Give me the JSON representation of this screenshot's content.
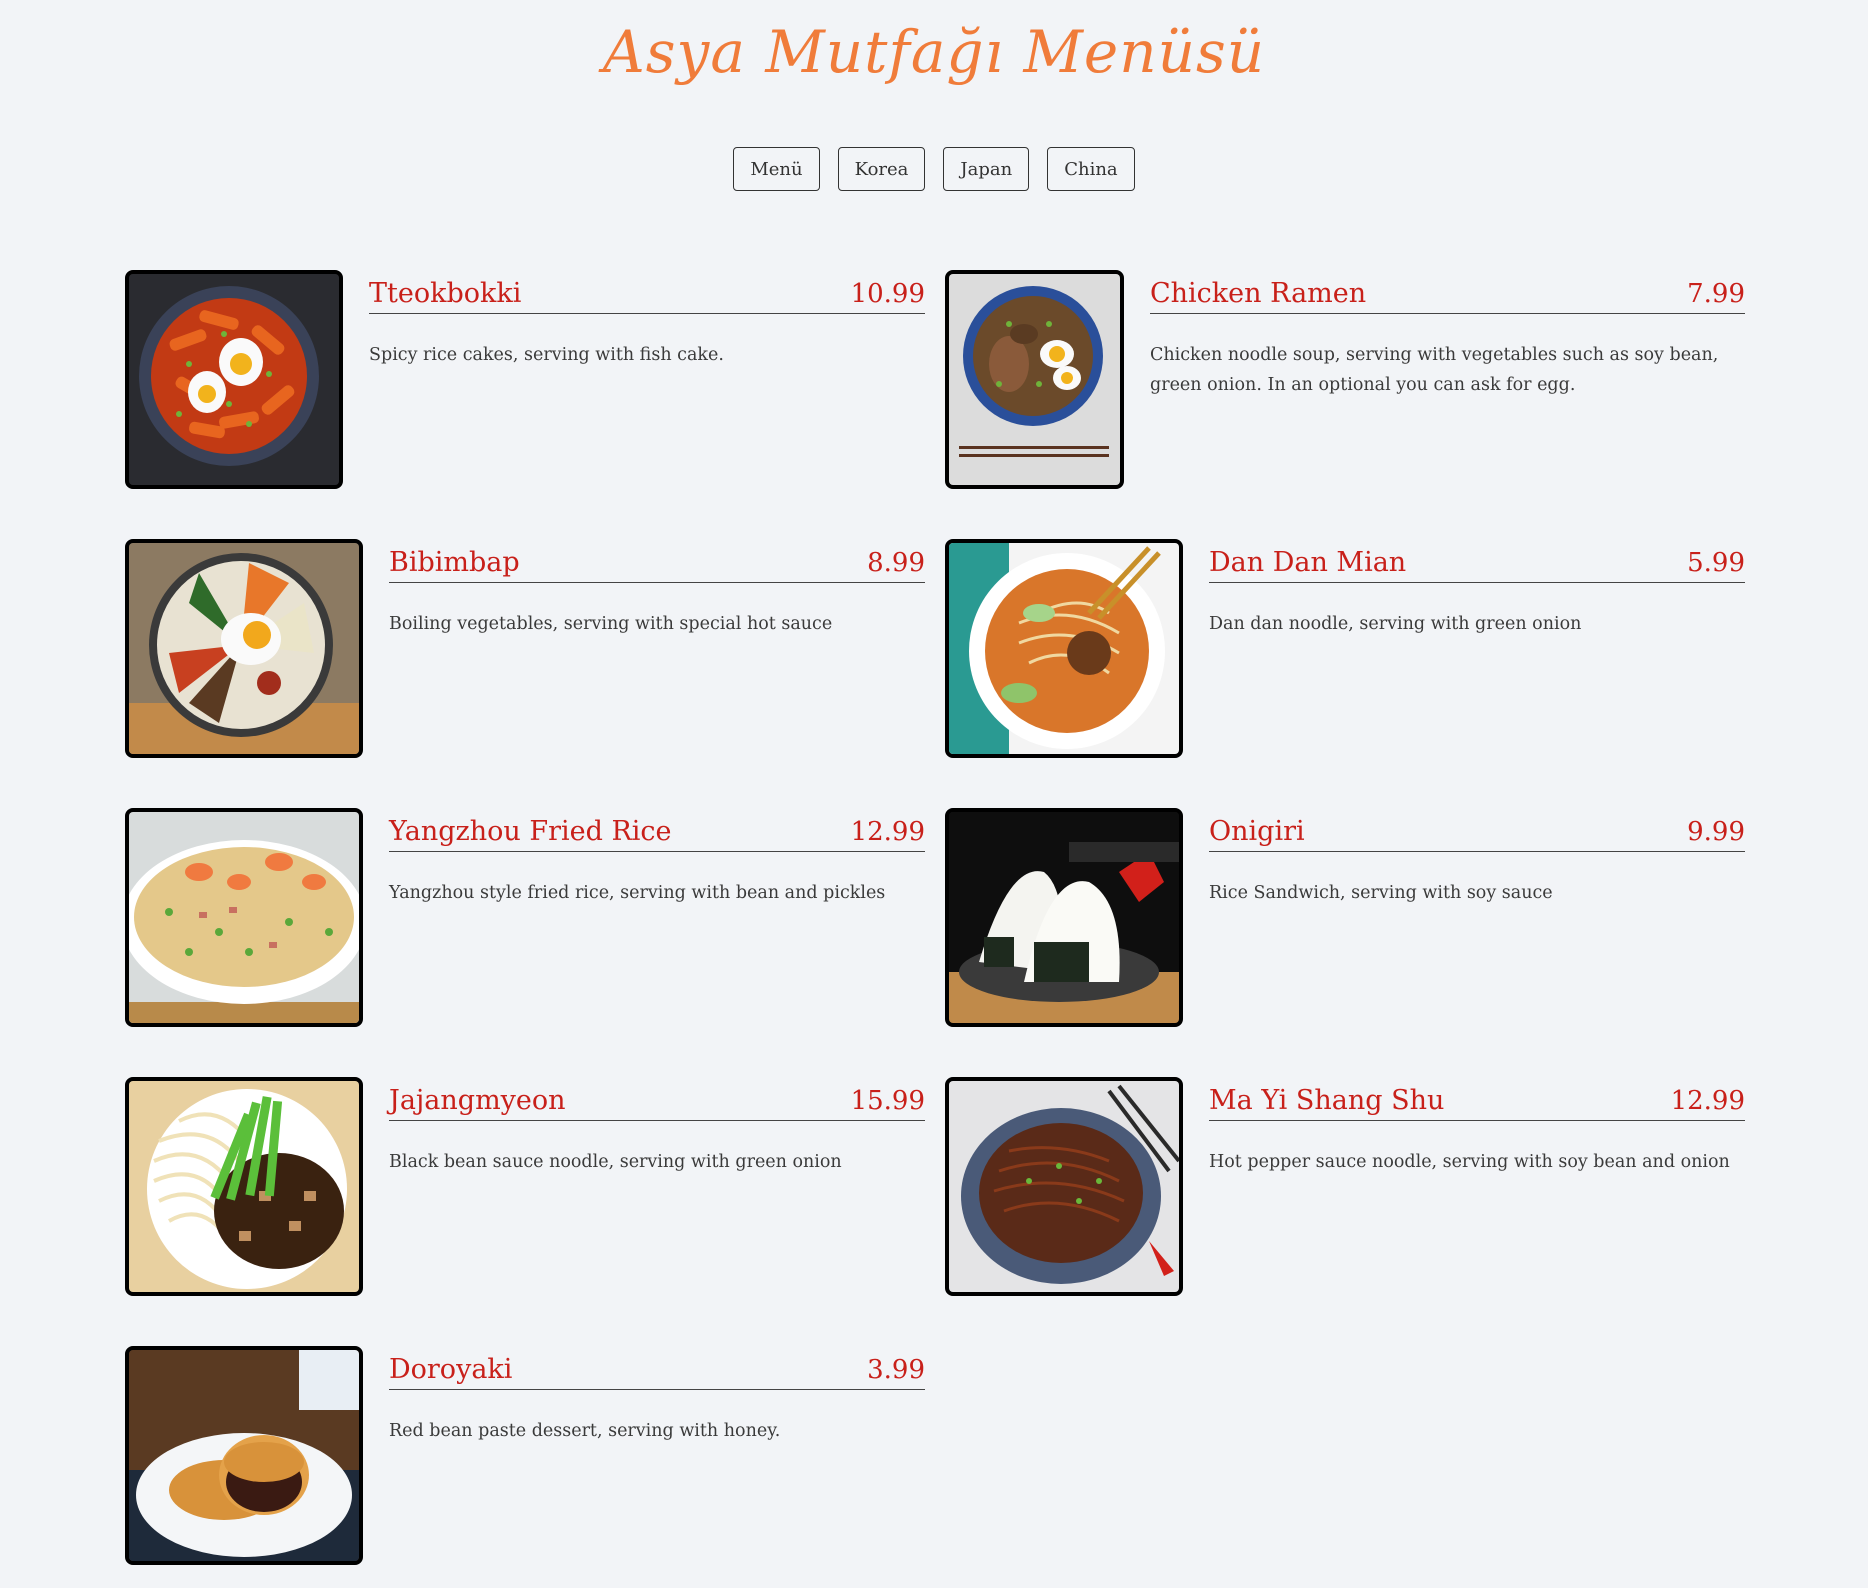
{
  "title": "Asya Mutfağı Menüsü",
  "filters": [
    "Menü",
    "Korea",
    "Japan",
    "China"
  ],
  "colors": {
    "background": "#f2f4f7",
    "title": "#f07c3a",
    "item_name": "#c8201a",
    "price": "#c8201a"
  },
  "items": [
    {
      "name": "Tteokbokki",
      "price": "10.99",
      "desc": "Spicy rice cakes, serving with fish cake.",
      "image": "tteokbokki-photo"
    },
    {
      "name": "Chicken Ramen",
      "price": "7.99",
      "desc": "Chicken noodle soup, serving with vegetables such as soy bean, green onion. In an optional you can ask for egg.",
      "image": "chicken-ramen-photo"
    },
    {
      "name": "Bibimbap",
      "price": "8.99",
      "desc": "Boiling vegetables, serving with special hot sauce",
      "image": "bibimbap-photo"
    },
    {
      "name": "Dan Dan Mian",
      "price": "5.99",
      "desc": "Dan dan noodle, serving with green onion",
      "image": "dan-dan-mian-photo"
    },
    {
      "name": "Yangzhou Fried Rice",
      "price": "12.99",
      "desc": "Yangzhou style fried rice, serving with bean and pickles",
      "image": "fried-rice-photo"
    },
    {
      "name": "Onigiri",
      "price": "9.99",
      "desc": "Rice Sandwich, serving with soy sauce",
      "image": "onigiri-photo"
    },
    {
      "name": "Jajangmyeon",
      "price": "15.99",
      "desc": "Black bean sauce noodle, serving with green onion",
      "image": "jajangmyeon-photo"
    },
    {
      "name": "Ma Yi Shang Shu",
      "price": "12.99",
      "desc": "Hot pepper sauce noodle, serving with soy bean and onion",
      "image": "ma-yi-shang-shu-photo"
    },
    {
      "name": "Doroyaki",
      "price": "3.99",
      "desc": "Red bean paste dessert, serving with honey.",
      "image": "doroyaki-photo"
    }
  ]
}
